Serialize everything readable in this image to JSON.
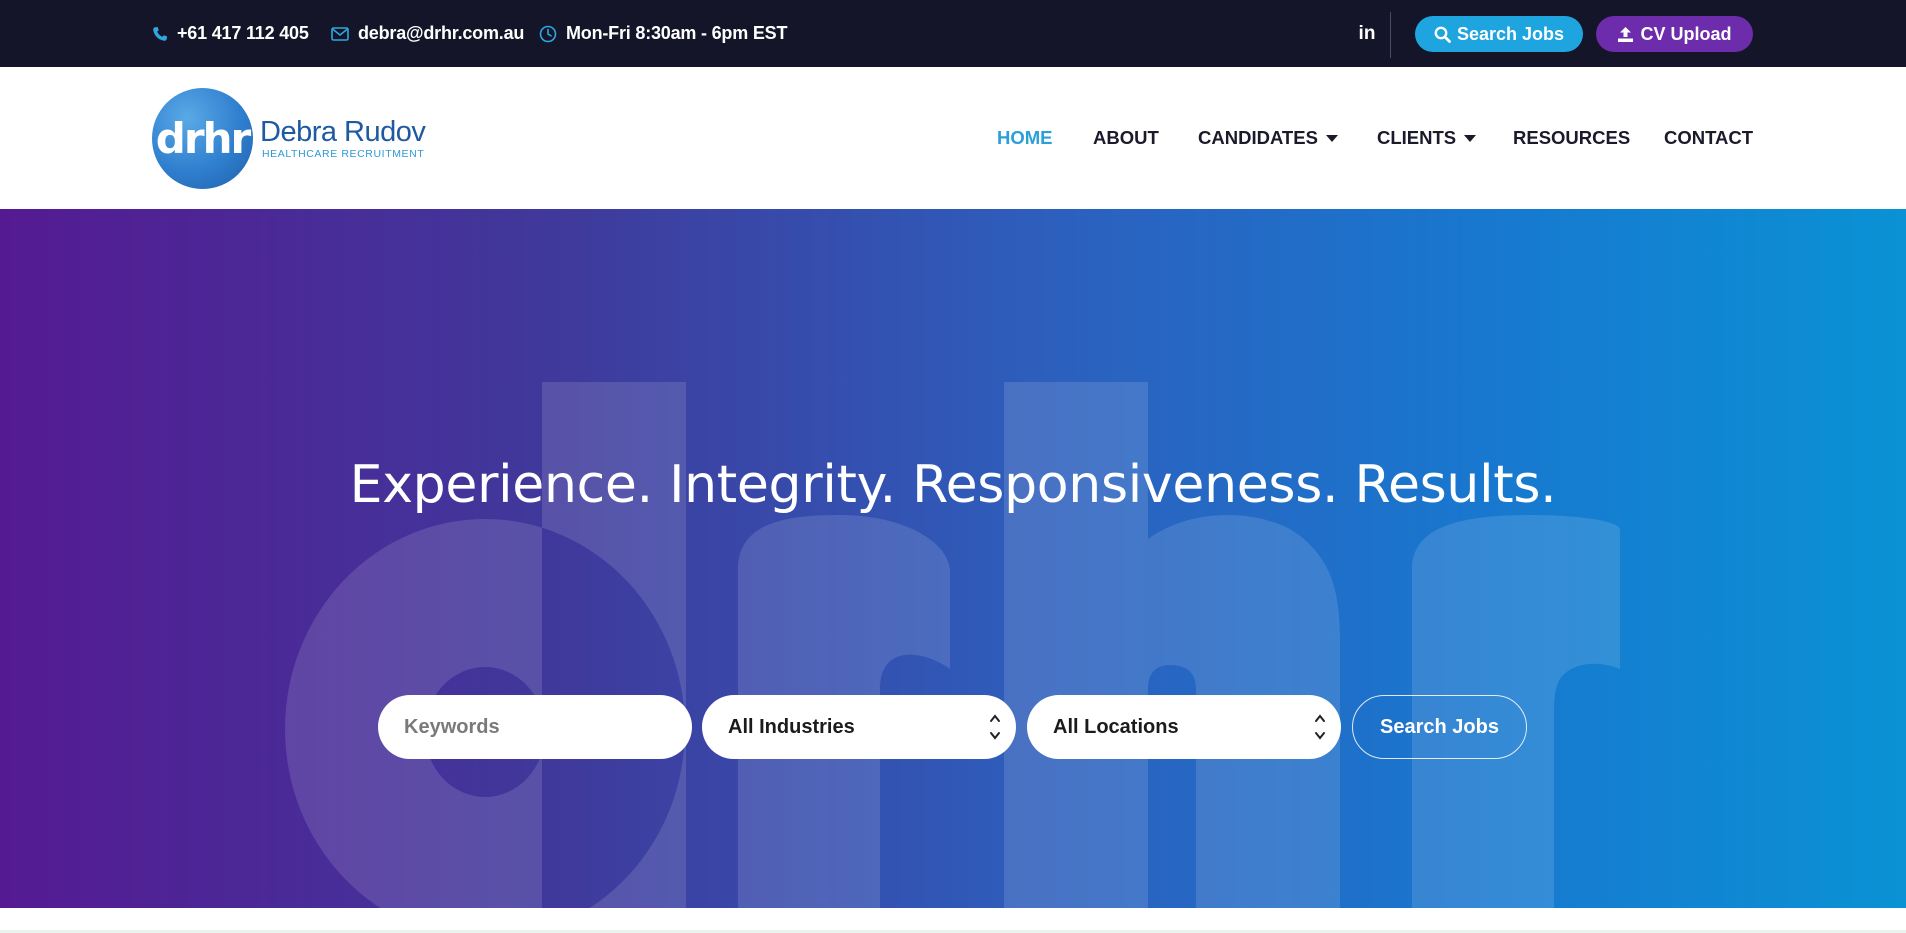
{
  "topbar": {
    "phone": "+61 417 112 405",
    "email": "debra@drhr.com.au",
    "hours": "Mon-Fri 8:30am - 6pm EST",
    "linkedin_label": "in",
    "search_jobs_label": "Search Jobs",
    "cv_upload_label": "CV Upload",
    "icons": {
      "phone": "phone-icon",
      "email": "envelope-icon",
      "hours": "clock-icon",
      "search": "search-icon",
      "upload": "upload-icon"
    },
    "colors": {
      "background": "#141528",
      "search_pill": "#1ea4df",
      "cv_pill": "#6c2cab"
    }
  },
  "logo": {
    "mark": "drhr",
    "name": "Debra Rudov",
    "subtitle": "HEALTHCARE RECRUITMENT"
  },
  "nav": {
    "items": [
      {
        "label": "HOME",
        "active": true,
        "dropdown": false
      },
      {
        "label": "ABOUT",
        "active": false,
        "dropdown": false
      },
      {
        "label": "CANDIDATES",
        "active": false,
        "dropdown": true
      },
      {
        "label": "CLIENTS",
        "active": false,
        "dropdown": true
      },
      {
        "label": "RESOURCES",
        "active": false,
        "dropdown": false
      },
      {
        "label": "CONTACT",
        "active": false,
        "dropdown": false
      }
    ],
    "active_color": "#2a9fd8"
  },
  "hero": {
    "title": "Experience. Integrity. Responsiveness. Results.",
    "watermark": "drhr",
    "gradient": [
      "#551a92",
      "#0a92d4"
    ],
    "search": {
      "keywords_placeholder": "Keywords",
      "industries_value": "All Industries",
      "locations_value": "All Locations",
      "button_label": "Search Jobs"
    }
  }
}
